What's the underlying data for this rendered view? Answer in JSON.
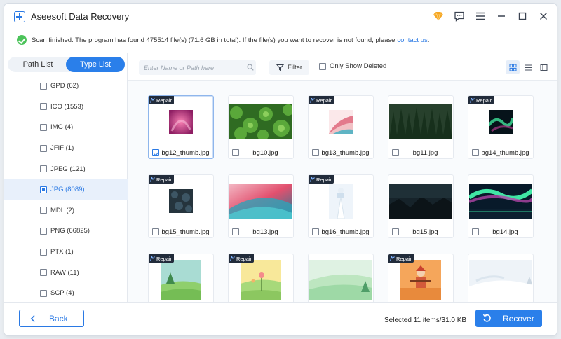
{
  "app": {
    "title": "Aseesoft Data Recovery"
  },
  "notice": {
    "text": "Scan finished. The program has found 475514 file(s) (71.6 GB in total). If the file(s) you want to recover is not found, please",
    "link": "contact us",
    "suffix": "."
  },
  "sidebar": {
    "tabs": [
      {
        "label": "Path List",
        "active": false
      },
      {
        "label": "Type List",
        "active": true
      }
    ],
    "types": [
      {
        "label": "GPD (62)"
      },
      {
        "label": "ICO (1553)"
      },
      {
        "label": "IMG (4)"
      },
      {
        "label": "JFIF (1)"
      },
      {
        "label": "JPEG (121)"
      },
      {
        "label": "JPG (8089)",
        "active": true
      },
      {
        "label": "MDL (2)"
      },
      {
        "label": "PNG (66825)"
      },
      {
        "label": "PTX (1)"
      },
      {
        "label": "RAW (11)"
      },
      {
        "label": "SCP (4)"
      }
    ]
  },
  "toolbar": {
    "search_placeholder": "Enter Name or Path here",
    "filter_label": "Filter",
    "only_deleted_label": "Only Show Deleted"
  },
  "badge_label": "Repair",
  "files": [
    {
      "name": "bg12_thumb.jpg",
      "repair": true,
      "selected": true
    },
    {
      "name": "bg10.jpg",
      "repair": false
    },
    {
      "name": "bg13_thumb.jpg",
      "repair": true
    },
    {
      "name": "bg11.jpg",
      "repair": false
    },
    {
      "name": "bg14_thumb.jpg",
      "repair": true
    },
    {
      "name": "bg15_thumb.jpg",
      "repair": true
    },
    {
      "name": "bg13.jpg",
      "repair": false
    },
    {
      "name": "bg16_thumb.jpg",
      "repair": true
    },
    {
      "name": "bg15.jpg",
      "repair": false
    },
    {
      "name": "bg14.jpg",
      "repair": false
    },
    {
      "name": "",
      "repair": true
    },
    {
      "name": "",
      "repair": true
    },
    {
      "name": "",
      "repair": false
    },
    {
      "name": "",
      "repair": true
    },
    {
      "name": "",
      "repair": false
    }
  ],
  "footer": {
    "back_label": "Back",
    "selected_info": "Selected 11 items/31.0 KB",
    "recover_label": "Recover"
  },
  "colors": {
    "accent": "#2a7fea",
    "success": "#4cc35a",
    "badge": "#222c3b",
    "crown": "#f5a623"
  }
}
